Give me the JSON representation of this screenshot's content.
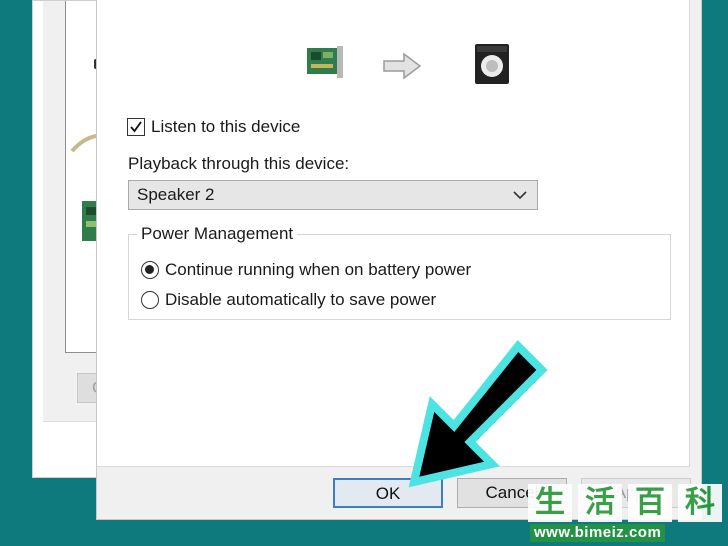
{
  "background_dialog": {
    "configure_button_label": "Co"
  },
  "properties_dialog": {
    "listen_checkbox": {
      "label": "Listen to this device",
      "checked": true
    },
    "playback": {
      "label": "Playback through this device:",
      "selected": "Speaker 2"
    },
    "power_management": {
      "title": "Power Management",
      "options": [
        {
          "label": "Continue running when on battery power",
          "selected": true
        },
        {
          "label": "Disable automatically to save power",
          "selected": false
        }
      ]
    },
    "buttons": {
      "ok": "OK",
      "cancel": "Cancel",
      "apply": "Apply"
    }
  },
  "watermark": {
    "chars": [
      "生",
      "活",
      "百",
      "科"
    ],
    "url": "www.bimeiz.com"
  },
  "colors": {
    "desktop": "#0f7a7e",
    "arrow_outline": "#4ee3e3",
    "arrow_fill": "#000000",
    "ok_border": "#3b7fc4"
  }
}
